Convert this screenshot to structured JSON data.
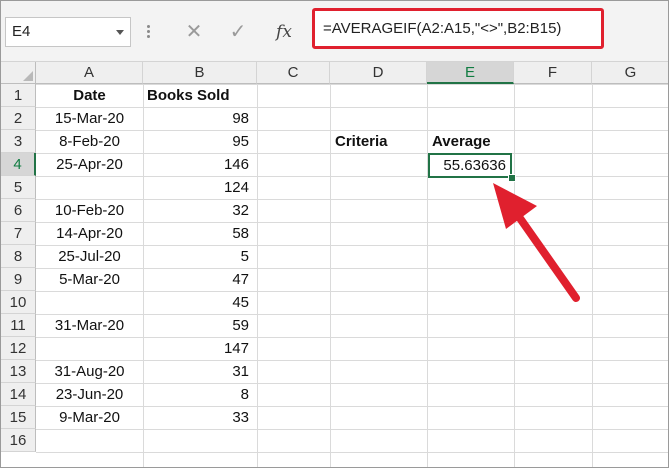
{
  "namebox": {
    "value": "E4"
  },
  "formula_bar": {
    "cancel_symbol": "✕",
    "enter_symbol": "✓",
    "fx_label": "fx",
    "formula": "=AVERAGEIF(A2:A15,\"<>\",B2:B15)"
  },
  "columns": [
    "A",
    "B",
    "C",
    "D",
    "E",
    "F",
    "G"
  ],
  "active_column": "E",
  "rows": [
    "1",
    "2",
    "3",
    "4",
    "5",
    "6",
    "7",
    "8",
    "9",
    "10",
    "11",
    "12",
    "13",
    "14",
    "15",
    "16"
  ],
  "active_row": "4",
  "cells": {
    "A1": "Date",
    "B1": "Books Sold",
    "A2": "15-Mar-20",
    "B2": "98",
    "A3": "8-Feb-20",
    "B3": "95",
    "A4": "25-Apr-20",
    "B4": "146",
    "A5": "",
    "B5": "124",
    "A6": "10-Feb-20",
    "B6": "32",
    "A7": "14-Apr-20",
    "B7": "58",
    "A8": "25-Jul-20",
    "B8": "5",
    "A9": "5-Mar-20",
    "B9": "47",
    "A10": "",
    "B10": "45",
    "A11": "31-Mar-20",
    "B11": "59",
    "A12": "",
    "B12": "147",
    "A13": "31-Aug-20",
    "B13": "31",
    "A14": "23-Jun-20",
    "B14": "8",
    "A15": "9-Mar-20",
    "B15": "33",
    "D3": "Criteria",
    "E3": "Average",
    "E4": "55.63636"
  },
  "colors": {
    "highlight_red": "#e0202e",
    "selection_green": "#217346"
  }
}
